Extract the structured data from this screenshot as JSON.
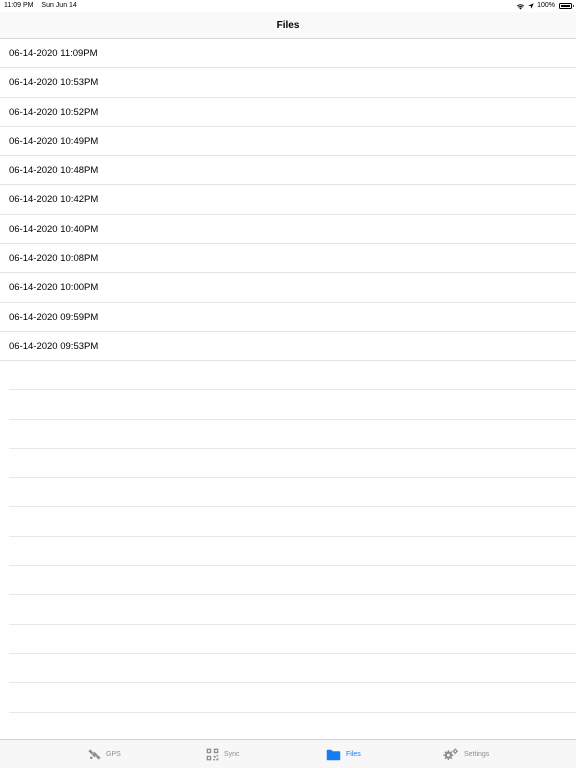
{
  "status_bar": {
    "time": "11:09 PM",
    "date": "Sun Jun 14",
    "battery": "100%",
    "icons": [
      "wifi-icon",
      "location-arrow-icon",
      "battery-icon"
    ]
  },
  "nav": {
    "title": "Files"
  },
  "files": [
    "06-14-2020 11:09PM",
    "06-14-2020 10:53PM",
    "06-14-2020 10:52PM",
    "06-14-2020 10:49PM",
    "06-14-2020 10:48PM",
    "06-14-2020 10:42PM",
    "06-14-2020 10:40PM",
    "06-14-2020 10:08PM",
    "06-14-2020 10:00PM",
    "06-14-2020 09:59PM",
    "06-14-2020 09:53PM"
  ],
  "tab_bar": {
    "tabs": [
      {
        "label": "GPS",
        "icon": "satellite-icon",
        "active": false
      },
      {
        "label": "Sync",
        "icon": "qr-code-icon",
        "active": false
      },
      {
        "label": "Files",
        "icon": "folder-icon",
        "active": true
      },
      {
        "label": "Settings",
        "icon": "gears-icon",
        "active": false
      }
    ]
  },
  "colors": {
    "accent": "#1a7cf5",
    "inactive": "#8e8e93"
  }
}
